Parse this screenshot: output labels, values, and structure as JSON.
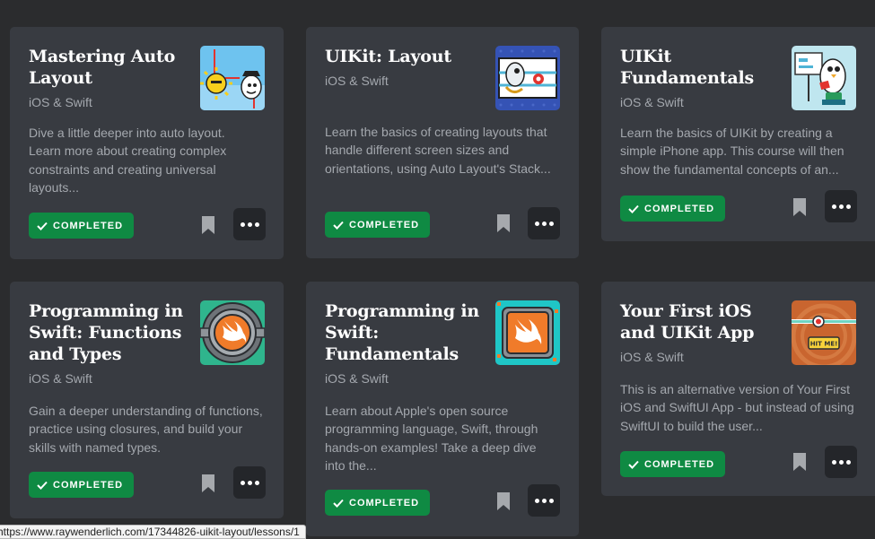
{
  "cards": [
    {
      "title": "Mastering Auto Layout",
      "subtitle": "iOS & Swift",
      "description": "Dive a little deeper into auto layout. Learn more about creating complex constraints and creating universal layouts...",
      "badge": "COMPLETED"
    },
    {
      "title": "UIKit: Layout",
      "subtitle": "iOS & Swift",
      "description": "Learn the basics of creating layouts that handle different screen sizes and orientations, using Auto Layout's Stack...",
      "badge": "COMPLETED"
    },
    {
      "title": "UIKit Fundamentals",
      "subtitle": "iOS & Swift",
      "description": "Learn the basics of UIKit by creating a simple iPhone app. This course will then show the fundamental concepts of an...",
      "badge": "COMPLETED"
    },
    {
      "title": "Programming in Swift: Functions and Types",
      "subtitle": "iOS & Swift",
      "description": "Gain a deeper understanding of functions, practice using closures, and build your skills with named types.",
      "badge": "COMPLETED"
    },
    {
      "title": "Programming in Swift: Fundamentals",
      "subtitle": "iOS & Swift",
      "description": "Learn about Apple's open source programming language, Swift, through hands-on examples! Take a deep dive into the...",
      "badge": "COMPLETED"
    },
    {
      "title": "Your First iOS and UIKit App",
      "subtitle": "iOS & Swift",
      "description": "This is an alternative version of Your First iOS and SwiftUI App - but instead of using SwiftUI to build the user...",
      "badge": "COMPLETED",
      "artwork_label": "HIT ME!"
    }
  ],
  "status_bar": {
    "url": "https://www.raywenderlich.com/17344826-uikit-layout/lessons/1"
  },
  "colors": {
    "page_background": "#2b2c2e",
    "card_background": "#383b41",
    "completed_badge": "#0f8a43",
    "muted_text": "#a4a8ae",
    "more_button": "#24262a"
  },
  "icons": {
    "badge": "checkmark-icon",
    "bookmark": "bookmark-icon",
    "more": "more-horizontal-icon"
  }
}
